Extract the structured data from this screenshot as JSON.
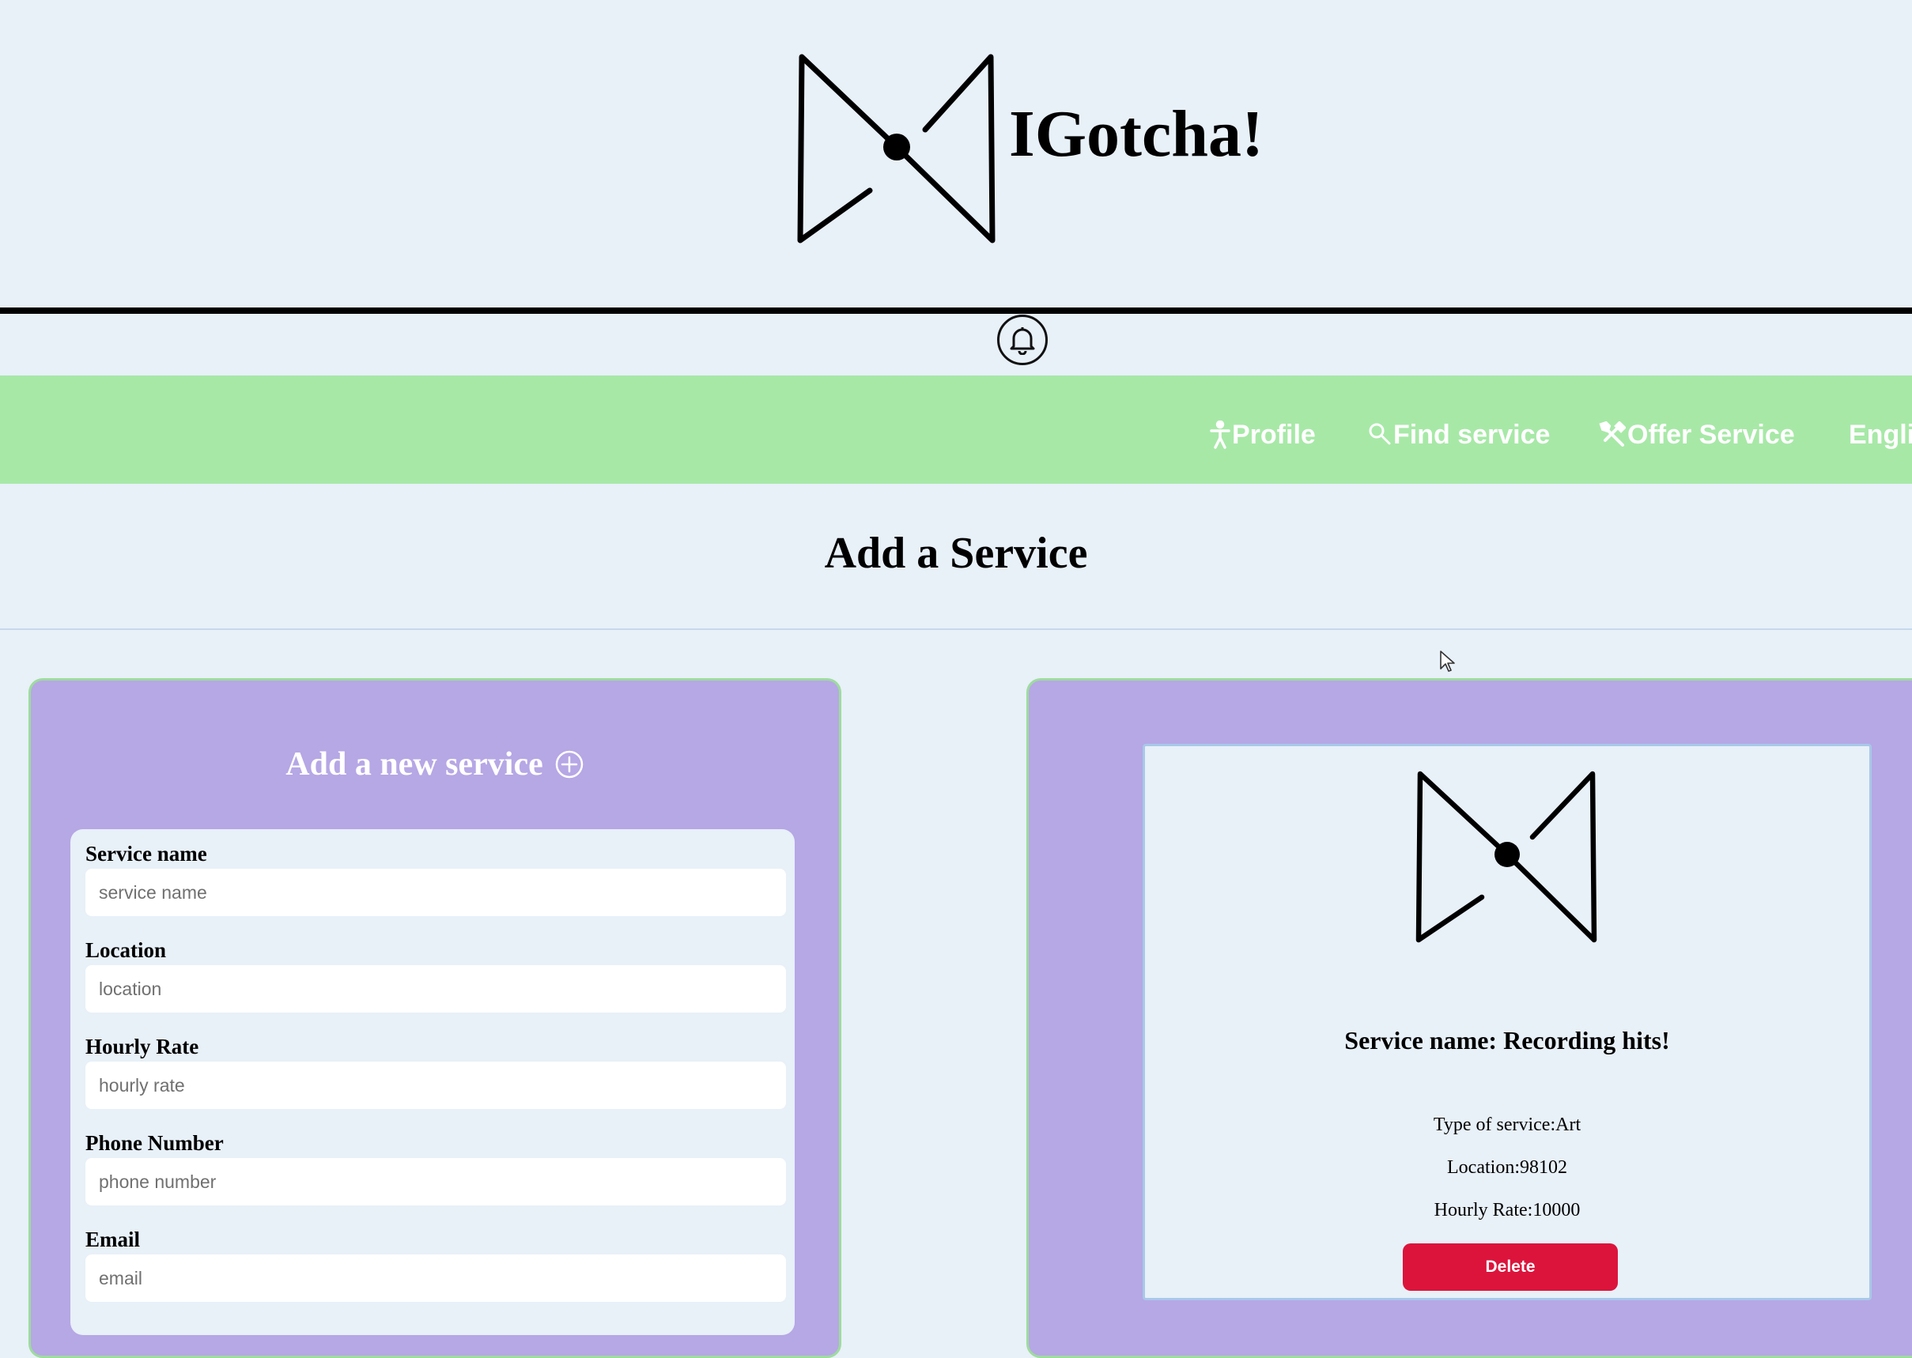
{
  "header": {
    "app_title": "IGotcha!",
    "logo_icon": "bowtie-logo-icon",
    "notification_icon": "bell-icon"
  },
  "nav": {
    "items": [
      {
        "label": "Profile",
        "icon": "person-icon"
      },
      {
        "label": "Find service",
        "icon": "search-icon"
      },
      {
        "label": "Offer Service",
        "icon": "tools-icon"
      },
      {
        "label": "Engli",
        "icon": ""
      }
    ]
  },
  "page": {
    "title": "Add a Service"
  },
  "form": {
    "heading": "Add a new service",
    "heading_icon": "plus-circle-icon",
    "fields": [
      {
        "label": "Service name",
        "placeholder": "service name"
      },
      {
        "label": "Location",
        "placeholder": "location"
      },
      {
        "label": "Hourly Rate",
        "placeholder": "hourly rate"
      },
      {
        "label": "Phone Number",
        "placeholder": "phone number"
      },
      {
        "label": "Email",
        "placeholder": "email"
      }
    ]
  },
  "service_card": {
    "name": "Service name: Recording hits!",
    "type": "Type of service:Art",
    "location": "Location:98102",
    "hourly_rate": "Hourly Rate:10000",
    "delete_label": "Delete"
  },
  "colors": {
    "background": "#e8f0f8",
    "nav_green": "#a7e8a7",
    "panel_purple": "#b6a7e5",
    "delete_red": "#dc143c"
  }
}
